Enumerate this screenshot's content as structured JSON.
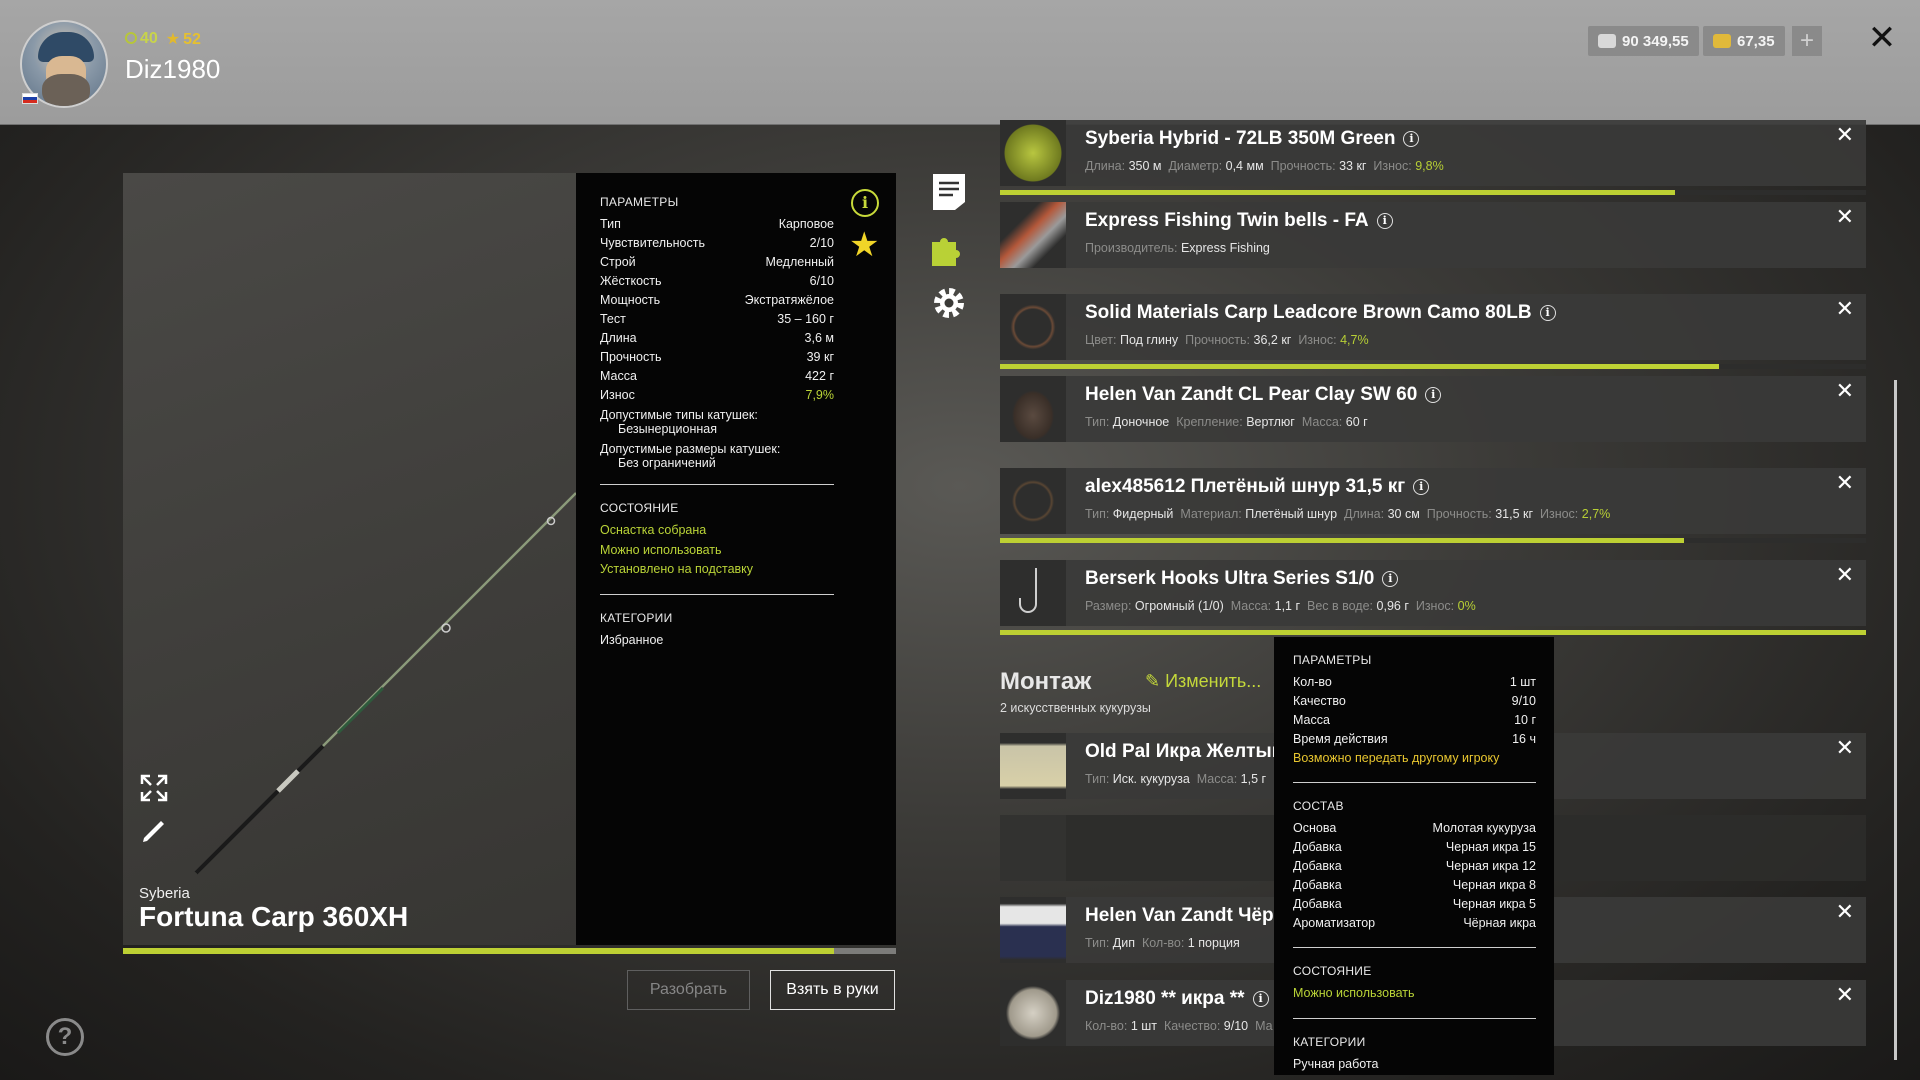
{
  "profile": {
    "level": "40",
    "stars": "52",
    "username": "Diz1980"
  },
  "currency": {
    "silver": "90 349,55",
    "gold": "67,35",
    "plus": "+"
  },
  "close": "✕",
  "rod": {
    "brand": "Syberia",
    "name": "Fortuna Carp 360XH"
  },
  "params": {
    "title": "ПАРАМЕТРЫ",
    "rows": [
      {
        "k": "Тип",
        "v": "Карповое"
      },
      {
        "k": "Чувствительность",
        "v": "2/10"
      },
      {
        "k": "Строй",
        "v": "Медленный"
      },
      {
        "k": "Жёсткость",
        "v": "6/10"
      },
      {
        "k": "Мощность",
        "v": "Экстратяжёлое"
      },
      {
        "k": "Тест",
        "v": "35 – 160 г"
      },
      {
        "k": "Длина",
        "v": "3,6 м"
      },
      {
        "k": "Прочность",
        "v": "39 кг"
      },
      {
        "k": "Масса",
        "v": "422 г"
      },
      {
        "k": "Износ",
        "v": "7,9%"
      }
    ],
    "reel_types_label": "Допустимые типы катушек:",
    "reel_types_value": "Безынерционная",
    "reel_sizes_label": "Допустимые размеры катушек:",
    "reel_sizes_value": "Без ограничений",
    "state_title": "СОСТОЯНИЕ",
    "state": [
      "Оснастка собрана",
      "Можно использовать",
      "Установлено на подставку"
    ],
    "cat_title": "КАТЕГОРИИ",
    "cat": "Избранное"
  },
  "rod_wear": 0.92,
  "buttons": {
    "disassemble": "Разобрать",
    "take": "Взять в руки"
  },
  "help": "?",
  "items": [
    {
      "title": "Syberia Hybrid - 72LB 350M Green",
      "desc": [
        [
          "Длина:",
          "350 м"
        ],
        [
          "Диаметр:",
          "0,4 мм"
        ],
        [
          "Прочность:",
          "33 кг"
        ],
        [
          "Износ:",
          "9,8%"
        ]
      ],
      "wear": 0.9
    },
    {
      "title": "Express Fishing Twin bells - FA",
      "desc": [
        [
          "Производитель:",
          "Express Fishing"
        ]
      ]
    },
    {
      "title": "Solid Materials Carp Leadcore Brown Camo 80LB",
      "desc": [
        [
          "Цвет:",
          "Под глину"
        ],
        [
          "Прочность:",
          "36,2 кг"
        ],
        [
          "Износ:",
          "4,7%"
        ]
      ],
      "wear": 0.95
    },
    {
      "title": "Helen Van Zandt CL Pear Clay SW 60",
      "desc": [
        [
          "Тип:",
          "Доночное"
        ],
        [
          "Крепление:",
          "Вертлюг"
        ],
        [
          "Масса:",
          "60 г"
        ]
      ]
    },
    {
      "title": "alex485612 Плетёный шнур 31,5 кг",
      "desc": [
        [
          "Тип:",
          "Фидерный"
        ],
        [
          "Материал:",
          "Плетёный шнур"
        ],
        [
          "Длина:",
          "30 см"
        ],
        [
          "Прочность:",
          "31,5 кг"
        ],
        [
          "Износ:",
          "2,7%"
        ]
      ],
      "wear": 0.97
    },
    {
      "title": "Berserk Hooks Ultra Series S1/0",
      "desc": [
        [
          "Размер:",
          "Огромный (1/0)"
        ],
        [
          "Масса:",
          "1,1 г"
        ],
        [
          "Вес в воде:",
          "0,96 г"
        ],
        [
          "Износ:",
          "0%"
        ]
      ],
      "wear": 1.0
    }
  ],
  "montazh": {
    "title": "Монтаж",
    "edit": "Изменить...",
    "sub": "2 искусственных кукурузы"
  },
  "bait_items": [
    {
      "title": "Old Pal Икра Желтый",
      "desc": [
        [
          "Тип:",
          "Иск. кукуруза"
        ],
        [
          "Масса:",
          "1,5 г"
        ]
      ]
    },
    {
      "title": "Helen Van Zandt Чёрн",
      "desc": [
        [
          "Тип:",
          "Дип"
        ],
        [
          "Кол-во:",
          "1 порция"
        ]
      ]
    },
    {
      "title": "Diz1980 ** икра **",
      "desc": [
        [
          "Кол-во:",
          "1 шт"
        ],
        [
          "Качество:",
          "9/10"
        ],
        [
          "Ма",
          ""
        ]
      ]
    }
  ],
  "tooltip": {
    "params_title": "ПАРАМЕТРЫ",
    "params": [
      {
        "k": "Кол-во",
        "v": "1 шт"
      },
      {
        "k": "Качество",
        "v": "9/10"
      },
      {
        "k": "Масса",
        "v": "10 г"
      },
      {
        "k": "Время действия",
        "v": "16 ч"
      }
    ],
    "transfer": "Возможно передать другому игроку",
    "comp_title": "СОСТАВ",
    "comp": [
      {
        "k": "Основа",
        "v": "Молотая кукуруза"
      },
      {
        "k": "Добавка",
        "v": "Черная икра 15"
      },
      {
        "k": "Добавка",
        "v": "Черная икра 12"
      },
      {
        "k": "Добавка",
        "v": "Черная икра 8"
      },
      {
        "k": "Добавка",
        "v": "Черная икра 5"
      },
      {
        "k": "Ароматизатор",
        "v": "Чёрная икра"
      }
    ],
    "state_title": "СОСТОЯНИЕ",
    "state": "Можно использовать",
    "cat_title": "КАТЕГОРИИ",
    "cat": "Ручная работа"
  },
  "colors": {
    "accent": "#bdd033",
    "yellow": "#e8c62f",
    "panel": "#050505"
  },
  "icons": {
    "level": "level-ring-icon",
    "stars": "star-icon",
    "silver": "silver-coin-icon",
    "gold": "gold-coin-icon",
    "notes": "notes-icon",
    "puzzle": "puzzle-icon",
    "settings": "gear-icon",
    "expand": "expand-icon",
    "pencil": "pencil-icon",
    "favorite": "star-icon",
    "info": "info-icon",
    "edit": "edit-icon"
  }
}
